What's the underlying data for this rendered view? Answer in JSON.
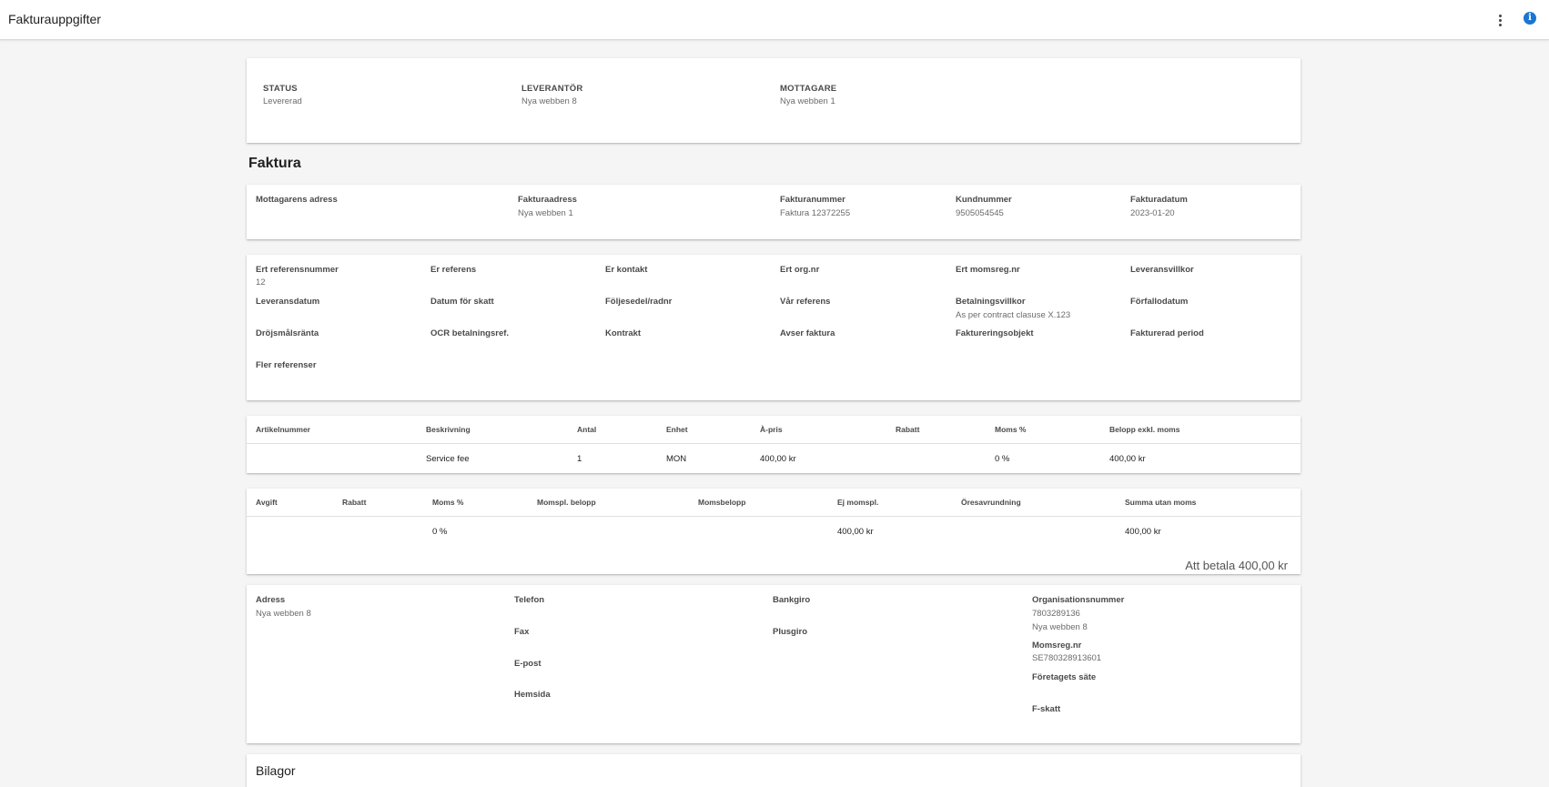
{
  "header": {
    "title": "Fakturauppgifter",
    "more_icon": "more-vert-icon",
    "info_icon": "info-icon",
    "info_glyph": "i",
    "accent": "#1976d2"
  },
  "summary": {
    "status_label": "STATUS",
    "status_value": "Levererad",
    "supplier_label": "LEVERANTÖR",
    "supplier_value": "Nya webben 8",
    "recipient_label": "MOTTAGARE",
    "recipient_value": "Nya webben 1"
  },
  "invoice": {
    "section_title": "Faktura",
    "recipient_address_label": "Mottagarens adress",
    "invoice_address_label": "Fakturaadress",
    "invoice_address_value": "Nya webben 1",
    "invoice_number_label": "Fakturanummer",
    "invoice_number_value": "Faktura 12372255",
    "customer_number_label": "Kundnummer",
    "customer_number_value": "9505054545",
    "invoice_date_label": "Fakturadatum",
    "invoice_date_value": "2023-01-20"
  },
  "references": {
    "your_ref_number_label": "Ert referensnummer",
    "your_ref_number_value": "12",
    "your_reference_label": "Er referens",
    "your_contact_label": "Er kontakt",
    "your_org_label": "Ert org.nr",
    "your_vat_label": "Ert momsreg.nr",
    "delivery_terms_label": "Leveransvillkor",
    "delivery_date_label": "Leveransdatum",
    "tax_date_label": "Datum för skatt",
    "delivery_note_label": "Följesedel/radnr",
    "our_reference_label": "Vår referens",
    "payment_terms_label": "Betalningsvillkor",
    "payment_terms_value": "As per contract clasuse X.123",
    "due_date_label": "Förfallodatum",
    "late_interest_label": "Dröjsmålsränta",
    "ocr_label": "OCR betalningsref.",
    "contract_label": "Kontrakt",
    "concerns_label": "Avser faktura",
    "billing_object_label": "Faktureringsobjekt",
    "billed_period_label": "Fakturerad period",
    "more_refs_label": "Fler referenser"
  },
  "lines": {
    "headers": [
      "Artikelnummer",
      "Beskrivning",
      "Antal",
      "Enhet",
      "À-pris",
      "Rabatt",
      "Moms %",
      "Belopp exkl. moms"
    ],
    "rows": [
      {
        "article": "",
        "description": "Service fee",
        "quantity": "1",
        "unit": "MON",
        "unit_price": "400,00 kr",
        "discount": "",
        "vat": "0 %",
        "amount": "400,00 kr"
      }
    ]
  },
  "totals": {
    "headers": [
      "Avgift",
      "Rabatt",
      "Moms %",
      "Momspl. belopp",
      "Momsbelopp",
      "Ej momspl.",
      "Öresavrundning",
      "Summa utan moms"
    ],
    "row": {
      "fee": "",
      "discount": "",
      "vat": "0 %",
      "vat_base": "",
      "vat_amount": "",
      "non_vat": "400,00 kr",
      "rounding": "",
      "sum_ex_vat": "400,00 kr"
    },
    "to_pay": "Att betala 400,00 kr"
  },
  "supplier_info": {
    "address_label": "Adress",
    "address_value": "Nya webben 8",
    "phone_label": "Telefon",
    "fax_label": "Fax",
    "email_label": "E-post",
    "website_label": "Hemsida",
    "bankgiro_label": "Bankgiro",
    "plusgiro_label": "Plusgiro",
    "org_number_label": "Organisationsnummer",
    "org_number_value": "7803289136",
    "org_name_value": "Nya webben 8",
    "vat_reg_label": "Momsreg.nr",
    "vat_reg_value": "SE780328913601",
    "seat_label": "Företagets säte",
    "ftax_label": "F-skatt"
  },
  "attachments": {
    "title": "Bilagor"
  }
}
